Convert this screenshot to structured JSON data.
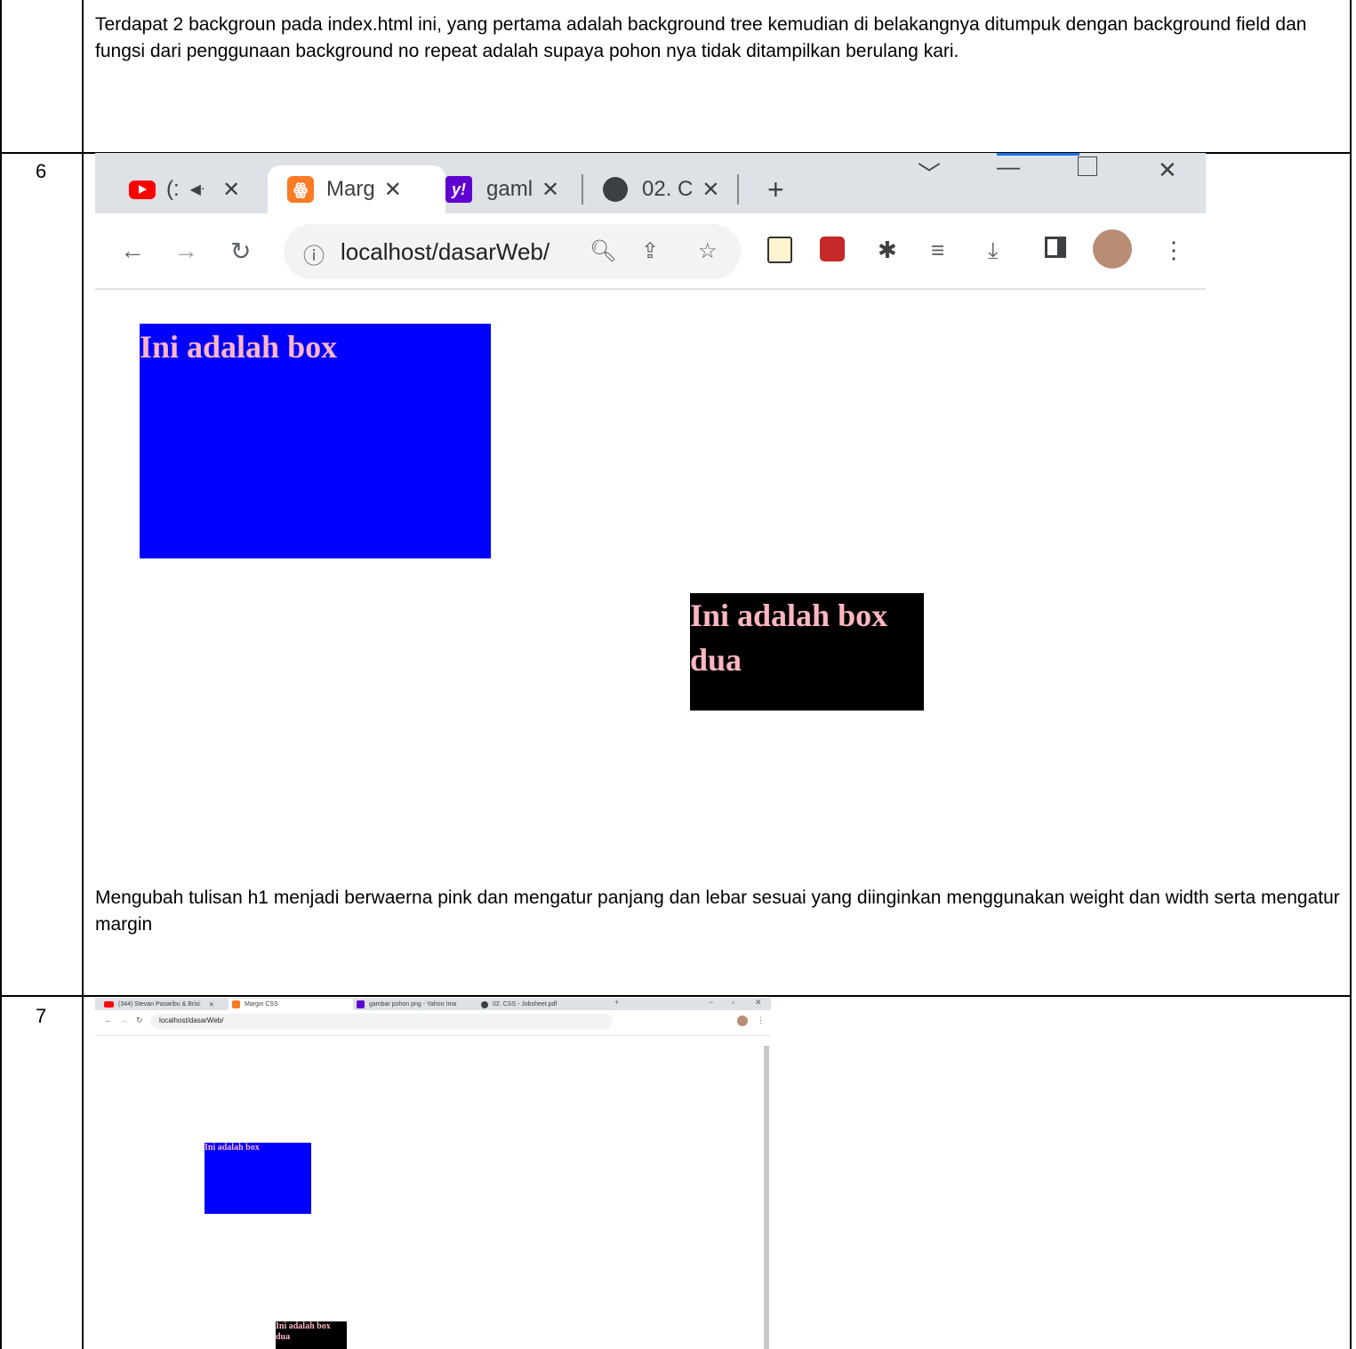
{
  "rows": [
    {
      "number": "",
      "text": "Terdapat 2 backgroun pada index.html ini, yang pertama adalah background tree kemudian di belakangnya ditumpuk dengan background field dan fungsi dari penggunaan background no repeat adalah supaya pohon nya tidak ditampilkan berulang kari."
    },
    {
      "number": "6",
      "caption": "Mengubah tulisan h1 menjadi berwaerna pink dan mengatur panjang dan lebar sesuai yang diinginkan menggunakan weight dan width serta mengatur margin",
      "browser": {
        "tabs": [
          {
            "label": "(:",
            "icon": "youtube-icon",
            "audio": "◀ᐧ"
          },
          {
            "label": "Marg",
            "icon": "xampp-icon"
          },
          {
            "label": "gaml",
            "icon": "yahoo-icon"
          },
          {
            "label": "02. C",
            "icon": "globe-icon"
          }
        ],
        "new_tab": "+",
        "url": "localhost/dasarWeb/",
        "colors": {
          "box1": "#0000ff",
          "box2": "#000000",
          "heading": "#ffb6c1"
        }
      },
      "page": {
        "box1_heading": "Ini adalah box",
        "box2_heading": "Ini adalah box dua"
      }
    },
    {
      "number": "7",
      "browser": {
        "tabs": [
          {
            "label": "(344) Stevan Pasaribu & Brisi"
          },
          {
            "label": "Margin CSS"
          },
          {
            "label": "gambar pohon png - Yahoo Ima"
          },
          {
            "label": "02. CSS - Jobsheet.pdf"
          }
        ],
        "url": "localhost/dasarWeb/"
      },
      "page": {
        "box1_heading": "Ini adalah box",
        "box2_heading": "Ini adalah box dua"
      }
    }
  ]
}
